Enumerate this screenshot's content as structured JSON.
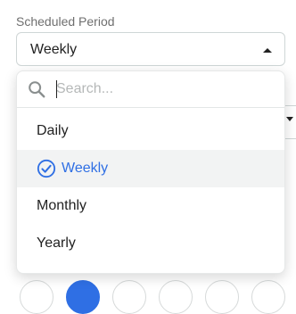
{
  "scheduled_period": {
    "label": "Scheduled Period",
    "selected_value": "Weekly",
    "search": {
      "placeholder": "Search...",
      "value": ""
    },
    "options": [
      {
        "label": "Daily",
        "selected": false
      },
      {
        "label": "Weekly",
        "selected": true
      },
      {
        "label": "Monthly",
        "selected": false
      },
      {
        "label": "Yearly",
        "selected": false
      }
    ]
  },
  "colors": {
    "accent": "#2f6fe4",
    "selected_row_bg": "#f2f3f3",
    "border": "#cfd6d6",
    "label_text": "#6f6f6f"
  },
  "icons": {
    "search": "search-icon",
    "selected_marker": "check-circle-icon",
    "caret": "caret-up-icon"
  }
}
